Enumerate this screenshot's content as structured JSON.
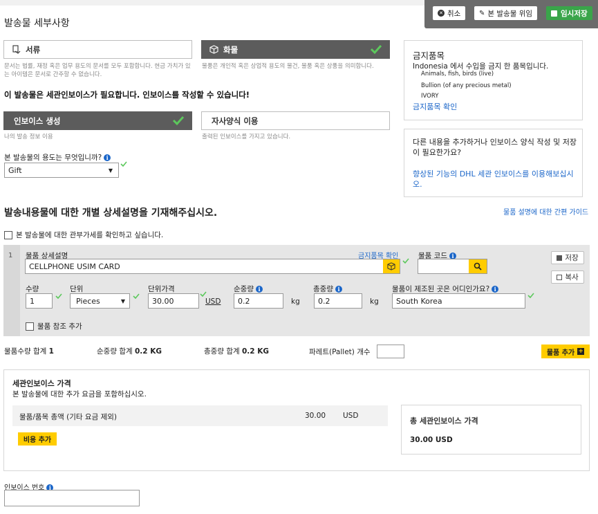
{
  "page_title": "발송물 세부사항",
  "toolbar": {
    "cancel_label": "취소",
    "template_label": "본 발송물 위임",
    "save_label": "임시저장"
  },
  "shipment_type": {
    "documents_label": "서류",
    "documents_note": "문서는 법률, 재정 혹은 업무 용도의 문서를 모두 포함합니다. 현금 가치가 있는 아이템은 문서로 간주할 수 없습니다.",
    "goods_label": "화물",
    "goods_note": "물품은 개인적 혹은 상업적 용도의 물건, 물품 혹은 상품을 의미합니다."
  },
  "invoice_required_msg": "이 발송물은 세관인보이스가 필요합니다. 인보이스를 작성할 수 있습니다!",
  "invoice_option": {
    "create_label": "인보이스 생성",
    "create_note": "나의 발송 정보 이용",
    "own_label": "자사양식 이용",
    "own_note": "출력된 인보이스를 가지고 있습니다."
  },
  "purpose": {
    "question": "본 발송물의 용도는 무엇입니까?",
    "value": "Gift"
  },
  "prohibited": {
    "title": "금지품목",
    "country": "Indonesia",
    "desc": "에서 수입을 금지 한 품목입니다.",
    "items": [
      "Animals, fish, birds (live)",
      "Bullion (of any precious metal)",
      "IVORY"
    ],
    "link": "금지품목 확인"
  },
  "help_box": {
    "text": "다른 내용을 추가하거나 인보이스 양식 작성 및 저장이 필요한가요?",
    "link": "향상된 기능의 DHL 세관 인보이스를 이용해보십시오."
  },
  "contents": {
    "heading": "발송내용물에 대한 개별 상세설명을 기재해주십시오.",
    "guide_link": "물품 설명에 대한 간편 가이드",
    "duty_check_label": "본 발송물에 대한 관부가세를 확인하고 싶습니다."
  },
  "item": {
    "index": "1",
    "desc_label": "물품 상세설명",
    "prohibited_link": "금지품목 확인",
    "desc_value": "CELLPHONE USIM CARD",
    "code_label": "물품 코드",
    "code_value": "",
    "save_label": "저장",
    "copy_label": "복사",
    "qty_label": "수량",
    "qty_value": "1",
    "unit_label": "단위",
    "unit_value": "Pieces",
    "price_label": "단위가격",
    "price_value": "30.00",
    "currency": "USD",
    "net_label": "순중량",
    "net_value": "0.2",
    "gross_label": "총중량",
    "gross_value": "0.2",
    "weight_unit": "kg",
    "origin_label": "물품이 제조된 곳은 어디인가요?",
    "origin_value": "South Korea",
    "ref_label": "물품 참조 추가"
  },
  "totals": {
    "qty_label": "물품수량 합계",
    "qty_value": "1",
    "net_label": "순중량 합계",
    "net_value": "0.2 KG",
    "gross_label": "총중량 합계",
    "gross_value": "0.2 KG",
    "pallet_label": "파레트(Pallet) 개수",
    "pallet_value": "",
    "add_item_label": "물품 추가"
  },
  "customs_value": {
    "title": "세관인보이스 가격",
    "subtitle": "본 발송물에 대한 추가 요금을 포함하십시오.",
    "row_label": "물품/품목 총액 (기타 요금 제외)",
    "row_amount": "30.00",
    "row_currency": "USD",
    "add_charge_label": "비용 추가",
    "total_title": "총 세관인보이스 가격",
    "total_value": "30.00 USD"
  },
  "invoice_number": {
    "label": "인보이스 번호",
    "value": ""
  },
  "colors": {
    "accent_yellow": "#ffcc00",
    "dark_gray": "#5c5c5c",
    "link_blue": "#1b66c9",
    "check_green": "#5cc85c",
    "save_green": "#3aa54a"
  }
}
